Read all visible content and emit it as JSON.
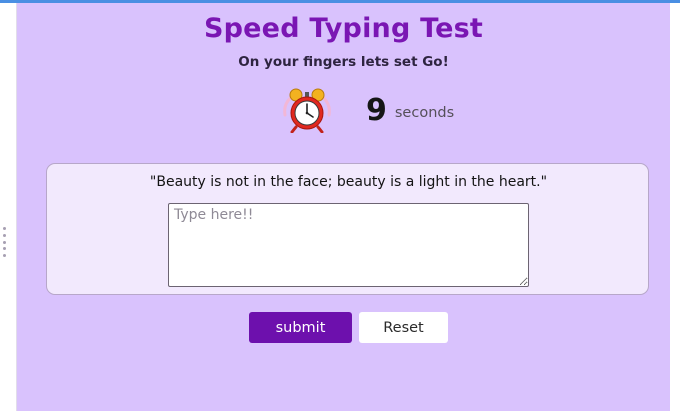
{
  "header": {
    "title": "Speed Typing Test",
    "subtitle": "On your fingers lets set Go!"
  },
  "timer": {
    "icon": "alarm-clock-icon",
    "value": "9",
    "unit": "seconds"
  },
  "quote": {
    "text": "\"Beauty is not in the face; beauty is a light in the heart.\""
  },
  "input": {
    "placeholder": "Type here!!",
    "value": ""
  },
  "actions": {
    "submit_label": "submit",
    "reset_label": "Reset"
  },
  "colors": {
    "background": "#d9c2fd",
    "title": "#7a16b3",
    "card": "#f2e9fd",
    "submit": "#6d10ad"
  }
}
